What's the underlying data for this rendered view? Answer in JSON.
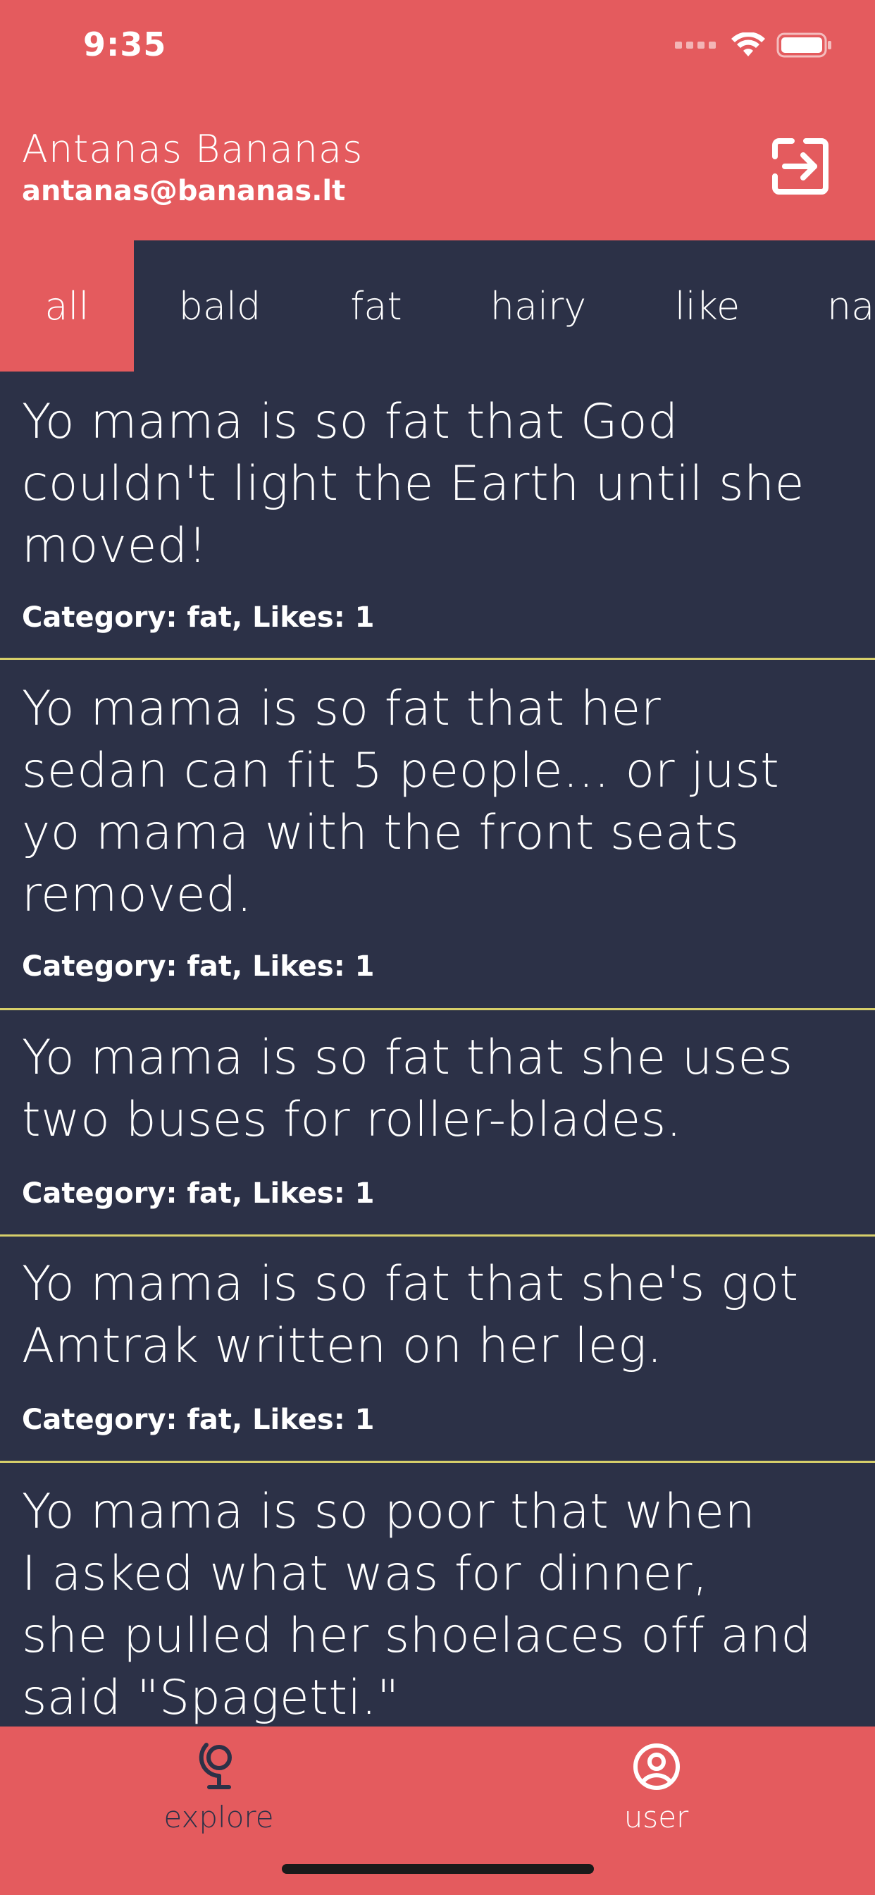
{
  "status_bar": {
    "time": "9:35"
  },
  "header": {
    "user_name": "Antanas Bananas",
    "user_email": "antanas@bananas.lt",
    "logout_icon": "logout-icon"
  },
  "tabs": [
    {
      "label": "all",
      "active": true
    },
    {
      "label": "bald",
      "active": false
    },
    {
      "label": "fat",
      "active": false
    },
    {
      "label": "hairy",
      "active": false
    },
    {
      "label": "like",
      "active": false
    },
    {
      "label": "na",
      "active": false
    }
  ],
  "jokes": [
    {
      "lines": [
        "Yo mama is so fat that God",
        "couldn't light the Earth until she",
        "moved!"
      ],
      "meta": "Category: fat, Likes: 1"
    },
    {
      "lines": [
        "Yo mama is so fat that her",
        "sedan can fit 5 people... or just",
        "yo mama with the front seats",
        "removed."
      ],
      "meta": "Category: fat, Likes: 1"
    },
    {
      "lines": [
        "Yo mama is so fat that she uses",
        "two buses for roller-blades."
      ],
      "meta": "Category: fat, Likes: 1"
    },
    {
      "lines": [
        "Yo mama is so fat that she's got",
        "Amtrak written on her leg."
      ],
      "meta": "Category: fat, Likes: 1"
    },
    {
      "lines": [
        "Yo mama is so poor that when",
        "I asked what was for dinner,",
        "she pulled her shoelaces off and",
        "said \"Spagetti.\""
      ],
      "meta": ""
    }
  ],
  "bottom_nav": [
    {
      "label": "explore",
      "icon": "globe-icon",
      "active": false
    },
    {
      "label": "user",
      "icon": "user-icon",
      "active": true
    }
  ],
  "colors": {
    "accent": "#e45b5e",
    "background": "#2c3147",
    "divider": "#d7cf6a"
  }
}
